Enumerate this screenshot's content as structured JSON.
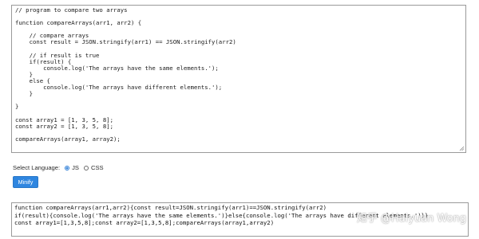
{
  "input_code": {
    "lines": [
      "// program to compare two arrays",
      "",
      "function compareArrays(arr1, arr2) {",
      "",
      "    // compare arrays",
      "    const result = JSON.stringify(arr1) == JSON.stringify(arr2)",
      "",
      "    // if result is true",
      "    if(result) {",
      "        console.log('The arrays have the same elements.');",
      "    }",
      "    else {",
      "        console.log('The arrays have different elements.');",
      "    }",
      "",
      "}",
      "",
      "const array1 = [1, 3, 5, 8];",
      "const array2 = [1, 3, 5, 8];",
      "",
      "compareArrays(array1, array2);"
    ]
  },
  "language": {
    "label": "Select Language:",
    "options": [
      "JS",
      "CSS"
    ],
    "selected": "JS"
  },
  "minify_button": {
    "label": "Minify"
  },
  "output_code": {
    "lines": [
      "function compareArrays(arr1,arr2){const result=JSON.stringify(arr1)==JSON.stringify(arr2)",
      "if(result){console.log('The arrays have the same elements.')}else{console.log('The arrays have different elements.')}}",
      "const array1=[1,3,5,8];const array2=[1,3,5,8];compareArrays(array1,array2)"
    ]
  },
  "watermark": {
    "text": "知乎 @Haiyuan Wong"
  },
  "colors": {
    "accent": "#2f86e0",
    "border": "#9a9a9a",
    "underline": "#d23b3b"
  }
}
